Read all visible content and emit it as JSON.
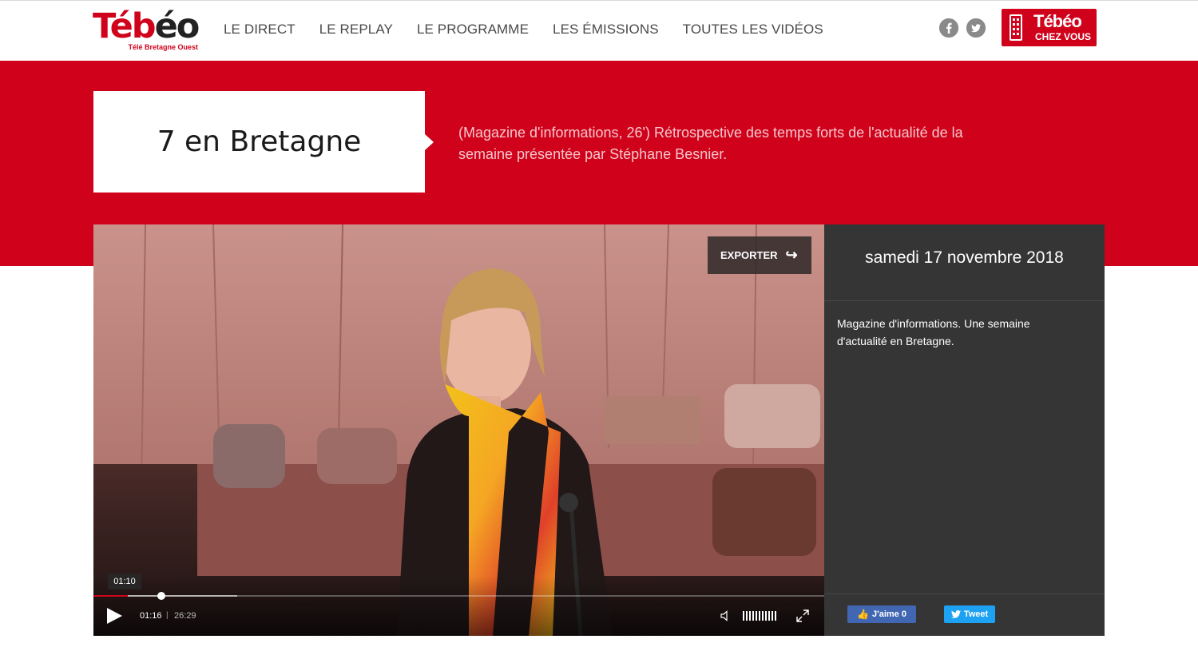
{
  "brand": {
    "logo_red": "Téb",
    "logo_dark": "éo",
    "tagline": "Télé Bretagne Ouest",
    "accent": "#d0021b"
  },
  "nav": {
    "items": [
      "LE DIRECT",
      "LE REPLAY",
      "LE PROGRAMME",
      "LES ÉMISSIONS",
      "TOUTES LES VIDÉOS"
    ]
  },
  "social": {
    "facebook_icon": "facebook-icon",
    "twitter_icon": "twitter-icon"
  },
  "cta": {
    "brand": "Tébéo",
    "sub": "CHEZ VOUS",
    "icon": "remote-control-icon"
  },
  "show": {
    "title": "7 en Bretagne",
    "description": "(Magazine d'informations, 26') Rétrospective des temps forts de l'actualité de la semaine présentée par Stéphane Besnier."
  },
  "player": {
    "export_label": "EXPORTER",
    "hover_time": "01:10",
    "current_time": "01:16",
    "separator": "|",
    "duration": "26:29",
    "progress_fraction": 0.047,
    "buffered_fraction": 0.197,
    "volume_fraction": 1.0
  },
  "sidebar": {
    "date": "samedi 17 novembre 2018",
    "summary": "Magazine d'informations. Une semaine d'actualité en Bretagne.",
    "like_label": "J'aime",
    "like_count": "0",
    "tweet_label": "Tweet"
  }
}
